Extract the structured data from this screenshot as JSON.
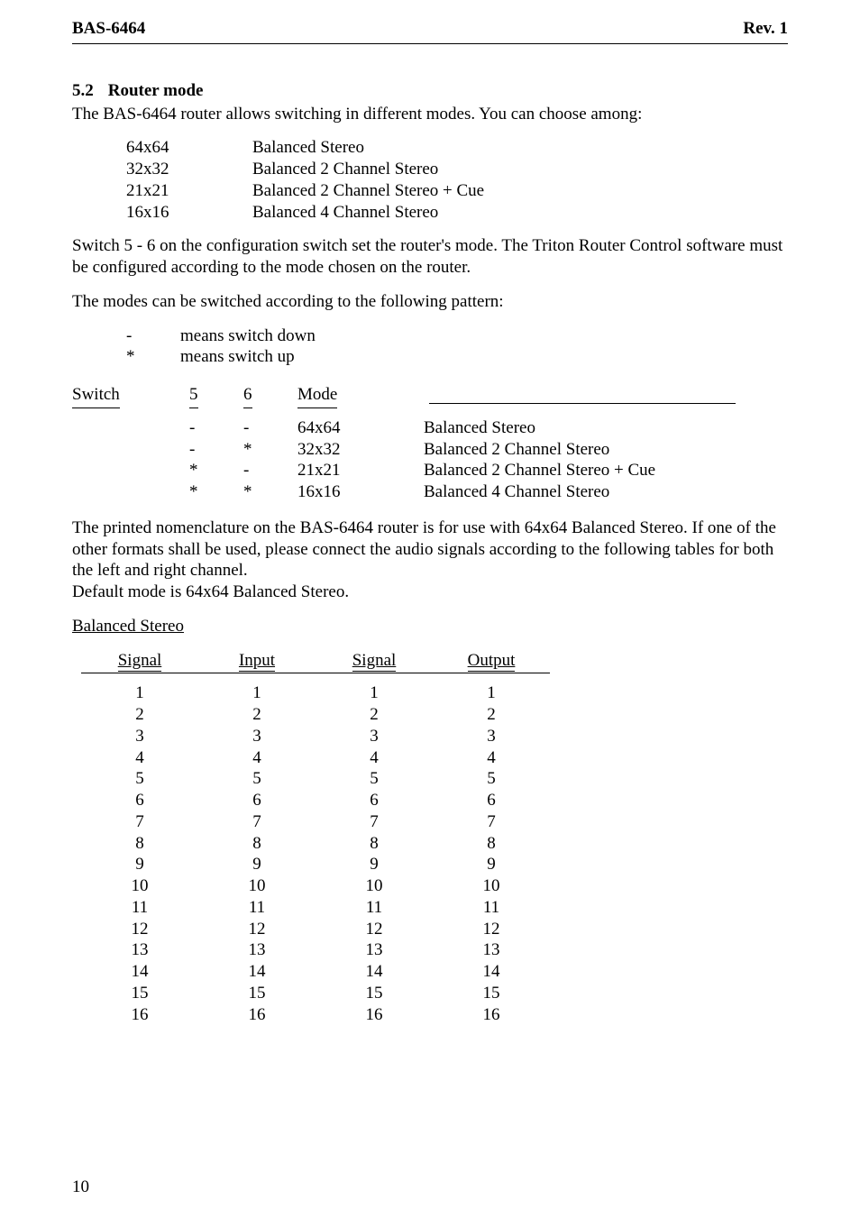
{
  "header": {
    "left": "BAS-6464",
    "right": "Rev. 1"
  },
  "section": {
    "number": "5.2",
    "title": "Router mode"
  },
  "intro": "The BAS-6464 router allows switching in different modes. You can choose among:",
  "mode_list": [
    {
      "code": "64x64",
      "desc": "Balanced Stereo"
    },
    {
      "code": "32x32",
      "desc": "Balanced 2 Channel Stereo"
    },
    {
      "code": "21x21",
      "desc": "Balanced 2 Channel Stereo + Cue"
    },
    {
      "code": "16x16",
      "desc": "Balanced 4 Channel Stereo"
    }
  ],
  "para_switch": "Switch 5 - 6 on the configuration switch set the router's mode. The Triton Router Control software must be configured according to the mode chosen on the router.",
  "para_pattern": "The modes can be switched according to the following pattern:",
  "legend": [
    {
      "sym": "-",
      "desc": "means switch down"
    },
    {
      "sym": "*",
      "desc": "means switch up"
    }
  ],
  "switch_table": {
    "label": "Switch",
    "h1": "5",
    "h2": "6",
    "h3": "Mode",
    "rows": [
      {
        "c1": "-",
        "c2": "-",
        "mode": "64x64",
        "desc": "Balanced Stereo"
      },
      {
        "c1": "-",
        "c2": "*",
        "mode": "32x32",
        "desc": "Balanced 2 Channel Stereo"
      },
      {
        "c1": "*",
        "c2": "-",
        "mode": "21x21",
        "desc": "Balanced 2 Channel Stereo + Cue"
      },
      {
        "c1": "*",
        "c2": "*",
        "mode": "16x16",
        "desc": "Balanced 4 Channel Stereo"
      }
    ]
  },
  "para_nomenclature": "The printed nomenclature on the BAS-6464 router is for use with 64x64 Balanced Stereo. If one of the other formats shall be used, please connect the audio signals according to the following tables for both the left and right channel.",
  "para_default": "Default mode is 64x64 Balanced Stereo.",
  "balanced_heading": "Balanced Stereo",
  "data_table": {
    "h1": "Signal",
    "h2": "Input",
    "h3": "Signal",
    "h4": "Output",
    "rows": [
      {
        "a": "1",
        "b": "1",
        "c": "1",
        "d": "1"
      },
      {
        "a": "2",
        "b": "2",
        "c": "2",
        "d": "2"
      },
      {
        "a": "3",
        "b": "3",
        "c": "3",
        "d": "3"
      },
      {
        "a": "4",
        "b": "4",
        "c": "4",
        "d": "4"
      },
      {
        "a": "5",
        "b": "5",
        "c": "5",
        "d": "5"
      },
      {
        "a": "6",
        "b": "6",
        "c": "6",
        "d": "6"
      },
      {
        "a": "7",
        "b": "7",
        "c": "7",
        "d": "7"
      },
      {
        "a": "8",
        "b": "8",
        "c": "8",
        "d": "8"
      },
      {
        "a": "9",
        "b": "9",
        "c": "9",
        "d": "9"
      },
      {
        "a": "10",
        "b": "10",
        "c": "10",
        "d": "10"
      },
      {
        "a": "11",
        "b": "11",
        "c": "11",
        "d": "11"
      },
      {
        "a": "12",
        "b": "12",
        "c": "12",
        "d": "12"
      },
      {
        "a": "13",
        "b": "13",
        "c": "13",
        "d": "13"
      },
      {
        "a": "14",
        "b": "14",
        "c": "14",
        "d": "14"
      },
      {
        "a": "15",
        "b": "15",
        "c": "15",
        "d": "15"
      },
      {
        "a": "16",
        "b": "16",
        "c": "16",
        "d": "16"
      }
    ]
  },
  "page_number": "10"
}
